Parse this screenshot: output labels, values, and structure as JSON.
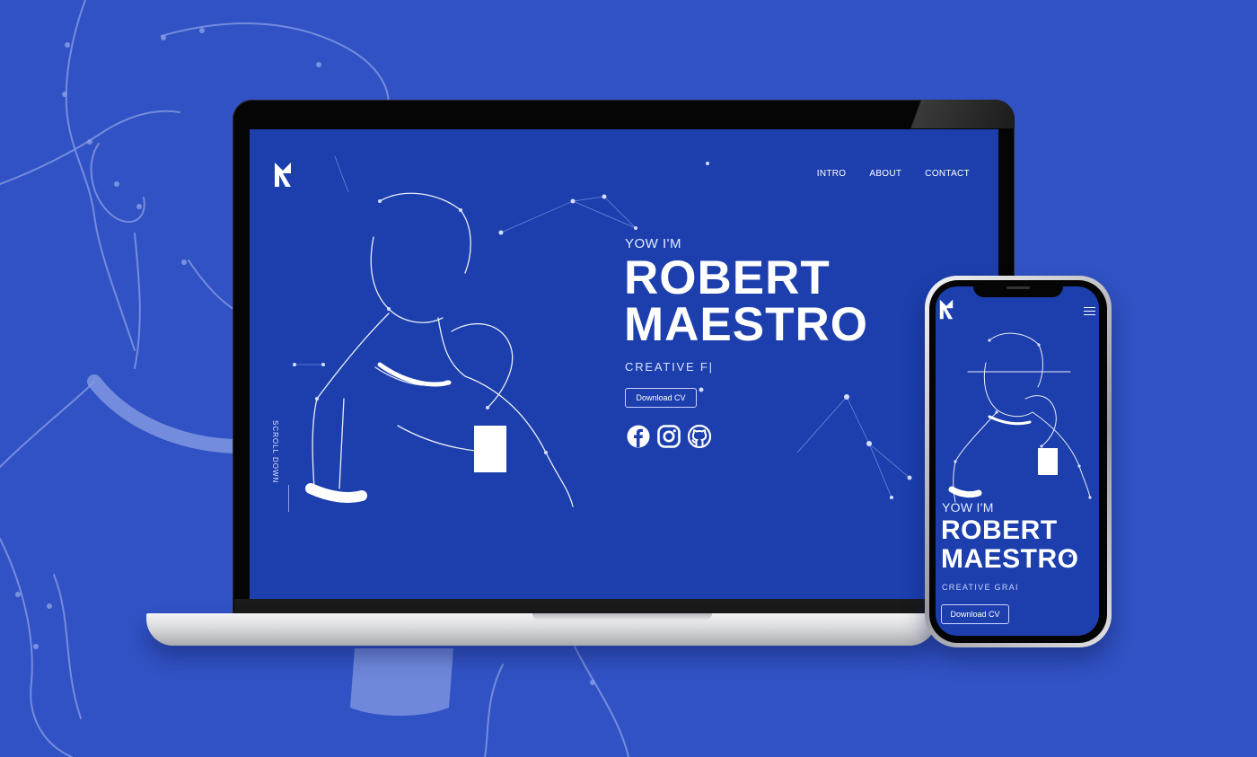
{
  "theme": {
    "background": "#3152c4",
    "screen": "#1c3fad",
    "accent": "#ffffff"
  },
  "desktop": {
    "logo": "logo-icon",
    "nav": [
      "INTRO",
      "ABOUT",
      "CONTACT"
    ],
    "greeting": "YOW I'M",
    "name_line1": "ROBERT",
    "name_line2": "MAESTRO",
    "role": "CREATIVE F|",
    "cv_button": "Download CV",
    "social_icons": [
      "facebook-icon",
      "instagram-icon",
      "github-icon"
    ],
    "scroll_label": "SCROLL DOWN"
  },
  "mobile": {
    "logo": "logo-icon",
    "menu_icon": "hamburger-icon",
    "greeting": "YOW I'M",
    "name_line1": "ROBERT",
    "name_line2": "MAESTRO",
    "role": "CREATIVE GRAI",
    "cv_button": "Download CV"
  }
}
